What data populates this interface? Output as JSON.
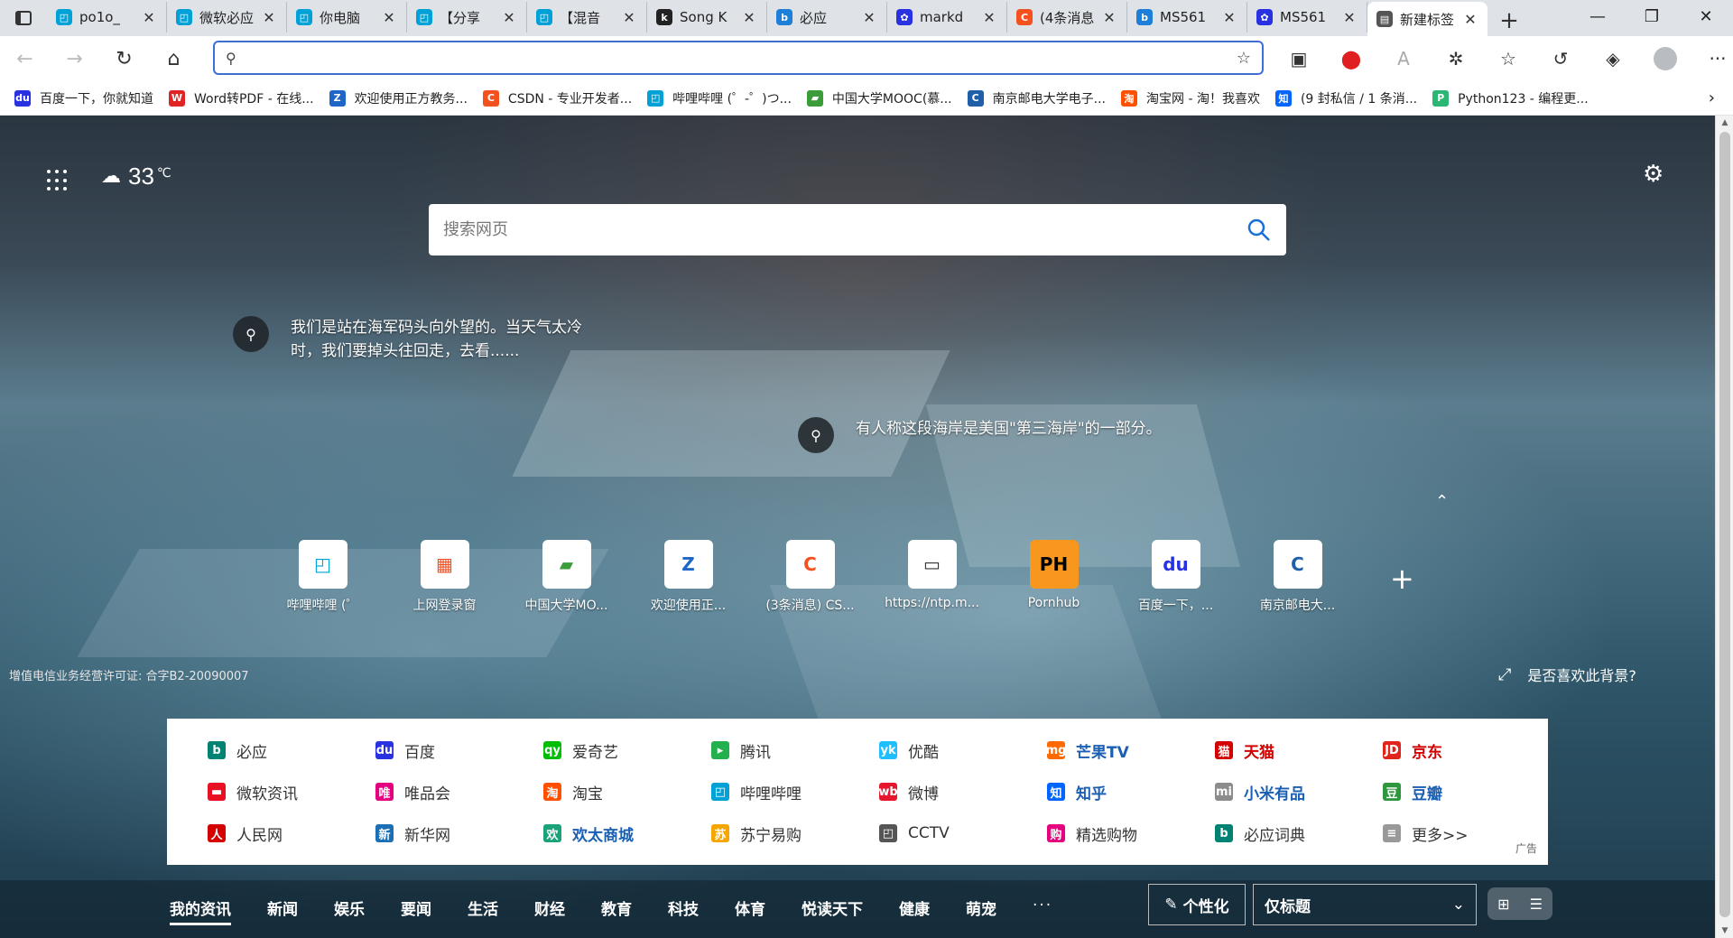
{
  "tabs": [
    {
      "title": "po1o_",
      "fav": "bili",
      "color": "#00a1d6"
    },
    {
      "title": "微软必应",
      "fav": "bili",
      "color": "#00a1d6"
    },
    {
      "title": "你电脑",
      "fav": "bili",
      "color": "#00a1d6"
    },
    {
      "title": "【分享",
      "fav": "bili",
      "color": "#00a1d6"
    },
    {
      "title": "【混音",
      "fav": "bili",
      "color": "#00a1d6"
    },
    {
      "title": "Song K",
      "fav": "key",
      "color": "#222"
    },
    {
      "title": "必应",
      "fav": "b",
      "color": "#1e7fd8"
    },
    {
      "title": "markd",
      "fav": "paw",
      "color": "#2932e1"
    },
    {
      "title": "(4条消息",
      "fav": "C",
      "color": "#f4511e"
    },
    {
      "title": "MS561",
      "fav": "b",
      "color": "#1e7fd8"
    },
    {
      "title": "MS561",
      "fav": "paw",
      "color": "#2932e1"
    },
    {
      "title": "新建标签",
      "fav": "page",
      "color": "#555"
    }
  ],
  "address": {
    "value": "",
    "placeholder": ""
  },
  "bookmarks": [
    {
      "label": "百度一下，你就知道",
      "color": "#2932e1",
      "icon": "du"
    },
    {
      "label": "Word转PDF - 在线...",
      "color": "#e02424",
      "icon": "W"
    },
    {
      "label": "欢迎使用正方教务...",
      "color": "#1e66c8",
      "icon": "Z"
    },
    {
      "label": "CSDN - 专业开发者...",
      "color": "#f4511e",
      "icon": "C"
    },
    {
      "label": "哔哩哔哩 (゜-゜)つ...",
      "color": "#00a1d6",
      "icon": "tv"
    },
    {
      "label": "中国大学MOOC(慕...",
      "color": "#3a9d3a",
      "icon": "M"
    },
    {
      "label": "南京邮电大学电子...",
      "color": "#1e5fa8",
      "icon": "C"
    },
    {
      "label": "淘宝网 - 淘！我喜欢",
      "color": "#ff5000",
      "icon": "淘"
    },
    {
      "label": "(9 封私信 / 1 条消...",
      "color": "#0066ff",
      "icon": "知"
    },
    {
      "label": "Python123 - 编程更...",
      "color": "#2bb673",
      "icon": "P"
    }
  ],
  "weather": {
    "temp": "33",
    "unit": "℃"
  },
  "search": {
    "placeholder": "搜索网页"
  },
  "hotspots": [
    {
      "text": "我们是站在海军码头向外望的。当天气太冷时，我们要掉头往回走，去看......"
    },
    {
      "text": "有人称这段海岸是美国\"第三海岸\"的一部分。"
    }
  ],
  "quicklinks": [
    {
      "label": "哔哩哔哩 (゜",
      "icon": "tv",
      "color": "#00a1d6"
    },
    {
      "label": "上网登录窗",
      "icon": "ms",
      "color": "#f25022"
    },
    {
      "label": "中国大学MO...",
      "icon": "M",
      "color": "#3a9d3a"
    },
    {
      "label": "欢迎使用正...",
      "icon": "Z",
      "color": "#1e66c8"
    },
    {
      "label": "(3条消息) CS...",
      "icon": "C",
      "color": "#f4511e"
    },
    {
      "label": "https://ntp.m...",
      "icon": "▭",
      "color": "#333"
    },
    {
      "label": "Pornhub",
      "icon": "PH",
      "color": "#000"
    },
    {
      "label": "百度一下，...",
      "icon": "du",
      "color": "#2932e1"
    },
    {
      "label": "南京邮电大...",
      "icon": "C",
      "color": "#1e5fa8"
    }
  ],
  "license": "增值电信业务经营许可证: 合字B2-20090007",
  "like_bg": "是否喜欢此背景?",
  "links": [
    {
      "label": "必应",
      "icon": "b",
      "color": "#008373",
      "style": ""
    },
    {
      "label": "百度",
      "icon": "du",
      "color": "#2932e1",
      "style": ""
    },
    {
      "label": "爱奇艺",
      "icon": "qy",
      "color": "#00be06",
      "style": ""
    },
    {
      "label": "腾讯",
      "icon": "▸",
      "color": "#23b14d",
      "style": ""
    },
    {
      "label": "优酷",
      "icon": "yk",
      "color": "#1ebeff",
      "style": ""
    },
    {
      "label": "芒果TV",
      "icon": "mg",
      "color": "#ff6a00",
      "style": "bold"
    },
    {
      "label": "天猫",
      "icon": "猫",
      "color": "#d40000",
      "style": "red"
    },
    {
      "label": "京东",
      "icon": "JD",
      "color": "#e1251b",
      "style": "red"
    },
    {
      "label": "微软资讯",
      "icon": "▬",
      "color": "#e81123",
      "style": ""
    },
    {
      "label": "唯品会",
      "icon": "唯",
      "color": "#e4007f",
      "style": ""
    },
    {
      "label": "淘宝",
      "icon": "淘",
      "color": "#ff5000",
      "style": ""
    },
    {
      "label": "哔哩哔哩",
      "icon": "tv",
      "color": "#00a1d6",
      "style": ""
    },
    {
      "label": "微博",
      "icon": "wb",
      "color": "#e6162d",
      "style": ""
    },
    {
      "label": "知乎",
      "icon": "知",
      "color": "#0066ff",
      "style": "bold"
    },
    {
      "label": "小米有品",
      "icon": "mi",
      "color": "#8c8c8c",
      "style": "bold"
    },
    {
      "label": "豆瓣",
      "icon": "豆",
      "color": "#2e963d",
      "style": "bold"
    },
    {
      "label": "人民网",
      "icon": "人",
      "color": "#d40000",
      "style": ""
    },
    {
      "label": "新华网",
      "icon": "新",
      "color": "#1a6fb5",
      "style": ""
    },
    {
      "label": "欢太商城",
      "icon": "欢",
      "color": "#1aa37a",
      "style": "bold"
    },
    {
      "label": "苏宁易购",
      "icon": "苏",
      "color": "#f7a600",
      "style": ""
    },
    {
      "label": "CCTV",
      "icon": "tv",
      "color": "#555",
      "style": ""
    },
    {
      "label": "精选购物",
      "icon": "购",
      "color": "#e4007f",
      "style": ""
    },
    {
      "label": "必应词典",
      "icon": "b",
      "color": "#008373",
      "style": ""
    },
    {
      "label": "更多>>",
      "icon": "≡",
      "color": "#999",
      "style": ""
    }
  ],
  "ad_label": "广告",
  "feed_tabs": [
    "我的资讯",
    "新闻",
    "娱乐",
    "要闻",
    "生活",
    "财经",
    "教育",
    "科技",
    "体育",
    "悦读天下",
    "健康",
    "萌宠",
    "···"
  ],
  "personalize": "个性化",
  "view_select": "仅标题"
}
